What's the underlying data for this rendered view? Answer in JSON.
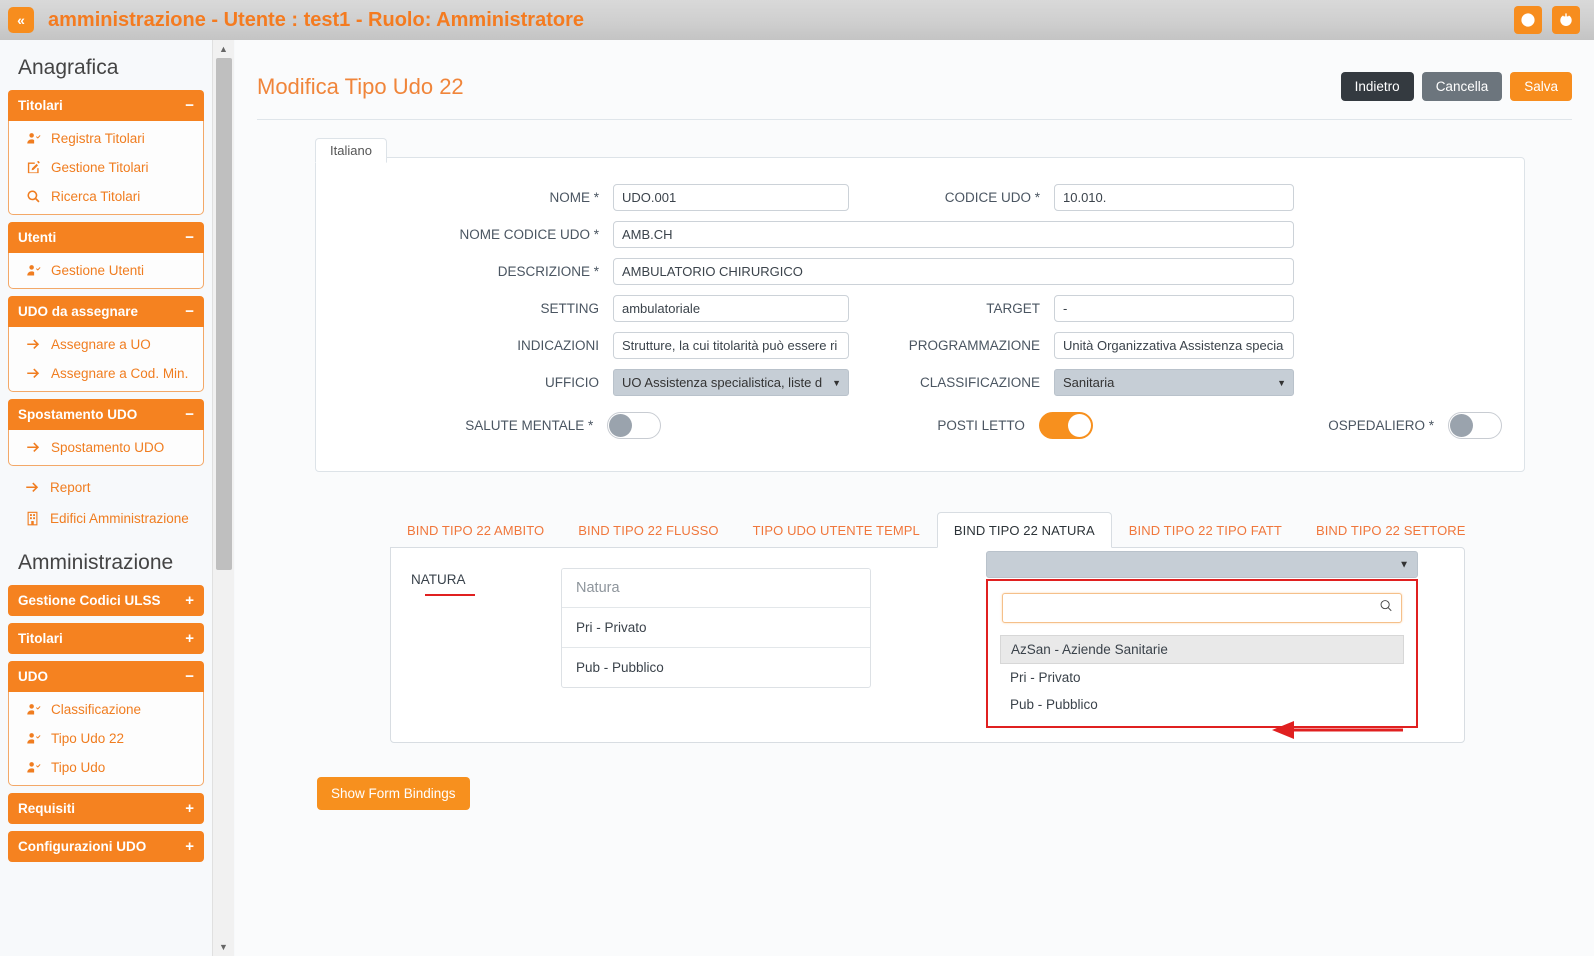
{
  "topbar": {
    "collapse_label": "«",
    "title": "amministrazione - Utente : test1 - Ruolo: Amministratore",
    "icons": [
      {
        "name": "globe-icon"
      },
      {
        "name": "power-icon"
      }
    ]
  },
  "sidebar": {
    "section_anagrafica": "Anagrafica",
    "section_amministrazione": "Amministrazione",
    "groups": [
      {
        "label": "Titolari",
        "sign": "−",
        "open": true,
        "items": [
          {
            "label": "Registra Titolari",
            "icon": "user-add-icon"
          },
          {
            "label": "Gestione Titolari",
            "icon": "edit-square-icon"
          },
          {
            "label": "Ricerca Titolari",
            "icon": "search-icon"
          }
        ]
      },
      {
        "label": "Utenti",
        "sign": "−",
        "open": true,
        "items": [
          {
            "label": "Gestione Utenti",
            "icon": "user-add-icon"
          }
        ]
      },
      {
        "label": "UDO da assegnare",
        "sign": "−",
        "open": true,
        "items": [
          {
            "label": "Assegnare a UO",
            "icon": "arrow-right-icon"
          },
          {
            "label": "Assegnare a Cod. Min.",
            "icon": "arrow-right-icon"
          }
        ]
      },
      {
        "label": "Spostamento UDO",
        "sign": "−",
        "open": true,
        "items": [
          {
            "label": "Spostamento UDO",
            "icon": "arrow-right-icon"
          }
        ]
      }
    ],
    "loose_items": [
      {
        "label": "Report",
        "icon": "arrow-right-icon"
      },
      {
        "label": "Edifici Amministrazione",
        "icon": "building-icon"
      }
    ],
    "groups2": [
      {
        "label": "Gestione Codici ULSS",
        "sign": "+",
        "open": false,
        "items": []
      },
      {
        "label": "Titolari",
        "sign": "+",
        "open": false,
        "items": []
      },
      {
        "label": "UDO",
        "sign": "−",
        "open": true,
        "items": [
          {
            "label": "Classificazione",
            "icon": "user-add-icon"
          },
          {
            "label": "Tipo Udo 22",
            "icon": "user-add-icon"
          },
          {
            "label": "Tipo Udo",
            "icon": "user-add-icon"
          }
        ]
      },
      {
        "label": "Requisiti",
        "sign": "+",
        "open": false,
        "items": []
      },
      {
        "label": "Configurazioni UDO",
        "sign": "+",
        "open": false,
        "items": []
      }
    ]
  },
  "page": {
    "title": "Modifica Tipo Udo 22",
    "buttons": {
      "back": "Indietro",
      "cancel": "Cancella",
      "save": "Salva"
    }
  },
  "form": {
    "lang_tab": "Italiano",
    "fields": {
      "nome_label": "NOME *",
      "nome_value": "UDO.001",
      "codice_udo_label": "CODICE UDO *",
      "codice_udo_value": "10.010.",
      "nome_codice_udo_label": "NOME CODICE UDO *",
      "nome_codice_udo_value": "AMB.CH",
      "descrizione_label": "DESCRIZIONE *",
      "descrizione_value": "AMBULATORIO CHIRURGICO",
      "setting_label": "SETTING",
      "setting_value": "ambulatoriale",
      "target_label": "TARGET",
      "target_value": "-",
      "indicazioni_label": "INDICAZIONI",
      "indicazioni_value": "Strutture, la cui titolarità può essere ri",
      "programmazione_label": "PROGRAMMAZIONE",
      "programmazione_value": "Unità Organizzativa Assistenza specia",
      "ufficio_label": "UFFICIO",
      "ufficio_value": "UO Assistenza specialistica, liste d",
      "classificazione_label": "CLASSIFICAZIONE",
      "classificazione_value": "Sanitaria",
      "salute_mentale_label": "SALUTE MENTALE *",
      "salute_mentale_on": false,
      "posti_letto_label": "POSTI LETTO",
      "posti_letto_on": true,
      "ospedaliero_label": "OSPEDALIERO *",
      "ospedaliero_on": false
    }
  },
  "tabs": [
    {
      "label": "BIND TIPO 22 AMBITO",
      "active": false
    },
    {
      "label": "BIND TIPO 22 FLUSSO",
      "active": false
    },
    {
      "label": "TIPO UDO UTENTE TEMPL",
      "active": false
    },
    {
      "label": "BIND TIPO 22 NATURA",
      "active": true
    },
    {
      "label": "BIND TIPO 22 TIPO FATT",
      "active": false
    },
    {
      "label": "BIND TIPO 22 SETTORE",
      "active": false
    }
  ],
  "natura": {
    "label": "NATURA",
    "table_header": "Natura",
    "rows": [
      {
        "value": "Pri - Privato"
      },
      {
        "value": "Pub - Pubblico"
      }
    ],
    "dropdown": {
      "selected": "",
      "search_value": "",
      "search_placeholder": "",
      "options": [
        {
          "label": "AzSan - Aziende Sanitarie",
          "highlighted": true
        },
        {
          "label": "Pri - Privato",
          "highlighted": false
        },
        {
          "label": "Pub - Pubblico",
          "highlighted": false
        }
      ]
    }
  },
  "footer": {
    "show_form_bindings": "Show Form Bindings"
  },
  "colors": {
    "accent_orange": "#f78d1e",
    "title_orange": "#f47b20",
    "annotation_red": "#e02020",
    "select_grey": "#c6ced6"
  }
}
